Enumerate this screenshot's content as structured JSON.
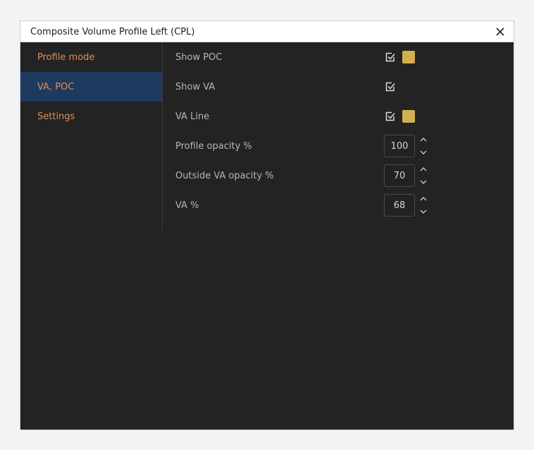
{
  "dialog": {
    "title": "Composite Volume Profile Left (CPL)"
  },
  "sidebar": {
    "items": [
      {
        "label": "Profile mode",
        "active": false
      },
      {
        "label": "VA, POC",
        "active": true
      },
      {
        "label": "Settings",
        "active": false
      }
    ]
  },
  "settings": {
    "show_poc": {
      "label": "Show POC",
      "checked": true,
      "color": "#d4af4f"
    },
    "show_va": {
      "label": "Show VA",
      "checked": true
    },
    "va_line": {
      "label": "VA Line",
      "checked": true,
      "color": "#d4af4f"
    },
    "profile_opacity": {
      "label": "Profile opacity %",
      "value": "100"
    },
    "outside_va_opacity": {
      "label": "Outside VA opacity %",
      "value": "70"
    },
    "va_percent": {
      "label": "VA %",
      "value": "68"
    }
  },
  "colors": {
    "accent_orange": "#e08f54",
    "active_bg": "#1e3a5f",
    "panel_bg": "#232323"
  },
  "icons": {
    "close": "close-icon",
    "check": "checkbox-checked-icon",
    "stepper": "chevron-up-down-icon"
  }
}
